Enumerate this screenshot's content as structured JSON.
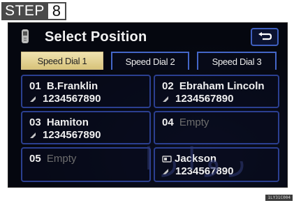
{
  "step": {
    "word": "STEP",
    "number": "8"
  },
  "header": {
    "title": "Select Position"
  },
  "tabs": [
    {
      "label": "Speed Dial 1",
      "active": true
    },
    {
      "label": "Speed Dial 2",
      "active": false
    },
    {
      "label": "Speed Dial 3",
      "active": false
    }
  ],
  "entries": [
    {
      "num": "01",
      "name": "B.Franklin",
      "phone": "1234567890"
    },
    {
      "num": "02",
      "name": "Ebraham Lincoln",
      "phone": "1234567890"
    },
    {
      "num": "03",
      "name": "Hamiton",
      "phone": "1234567890"
    },
    {
      "num": "04",
      "empty": "Empty"
    },
    {
      "num": "05",
      "empty": "Empty"
    },
    {
      "num": "",
      "name": "Jackson",
      "phone": "1234567890"
    }
  ],
  "figure_code": "1LY31C004",
  "colors": {
    "tab_active": "#e6d08e",
    "border_blue": "#2b3f90",
    "screen_bg": "#05070f"
  }
}
